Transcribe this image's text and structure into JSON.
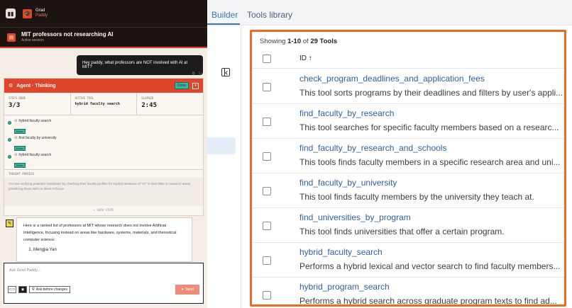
{
  "chat": {
    "brand": {
      "name": "Grad",
      "sub": "Paddy"
    },
    "session": {
      "title": "MIT professors not researching AI",
      "subtitle": "Active session"
    },
    "user_message": "Hey paddy, what professors are NOT involved with AI at MIT?",
    "agent": {
      "title": "Agent · Thinking",
      "status": "Done",
      "steps_done_label": "STEPS DONE",
      "steps_done": "3/3",
      "active_tool_label": "ACTIVE TOOL",
      "active_tool": "hybrid faculty search",
      "elapsed_label": "ELAPSED",
      "elapsed": "2:45",
      "steps": [
        {
          "name": "hybrid faculty search",
          "status": "Done"
        },
        {
          "name": "find faculty by university",
          "status": "Done"
        },
        {
          "name": "hybrid faculty search",
          "status": "Done"
        }
      ],
      "thought_label": "THOUGHT PROCESS",
      "thought": "I'm now verifying potential candidates by checking their faculty profiles for explicit mentions of \"AI\" in their titles or research areas, prioritizing those with no direct AI focus.",
      "show_steps": "+ SHOW STEPS"
    },
    "bot_message": {
      "text": "Here is a ranked list of professors at MIT whose research does not involve Artificial Intelligence, focusing instead on areas like hardware, systems, materials, and theoretical computer science:",
      "items": [
        "Mengjia Yan"
      ]
    },
    "input": {
      "placeholder": "Ask Grad Paddy...",
      "ask_label": "Ask before changes",
      "send_label": "Send"
    }
  },
  "tools": {
    "tabs": {
      "builder": "Builder",
      "library": "Tools library"
    },
    "showing": {
      "prefix": "Showing ",
      "range": "1-10",
      "middle": " of ",
      "total": "29",
      "suffix": " Tools"
    },
    "id_header": "ID ↑",
    "rows": [
      {
        "name": "check_program_deadlines_and_application_fees",
        "desc": "This tool sorts programs by their deadlines and filters by user's appli..."
      },
      {
        "name": "find_faculty_by_research",
        "desc": "This tool searches for specific faculty members based on a researc..."
      },
      {
        "name": "find_faculty_by_research_and_schools",
        "desc": "This tools finds faculty members in a specific research area and uni..."
      },
      {
        "name": "find_faculty_by_university",
        "desc": "This tool finds faculty members by the university they teach at."
      },
      {
        "name": "find_universities_by_program",
        "desc": "This tool finds universities that offer a certain program."
      },
      {
        "name": "hybrid_faculty_search",
        "desc": "Performs a hybrid lexical and vector search to find faculty members..."
      },
      {
        "name": "hybrid_program_search",
        "desc": "Performs a hybrid search across graduate program texts to find ad..."
      }
    ]
  }
}
